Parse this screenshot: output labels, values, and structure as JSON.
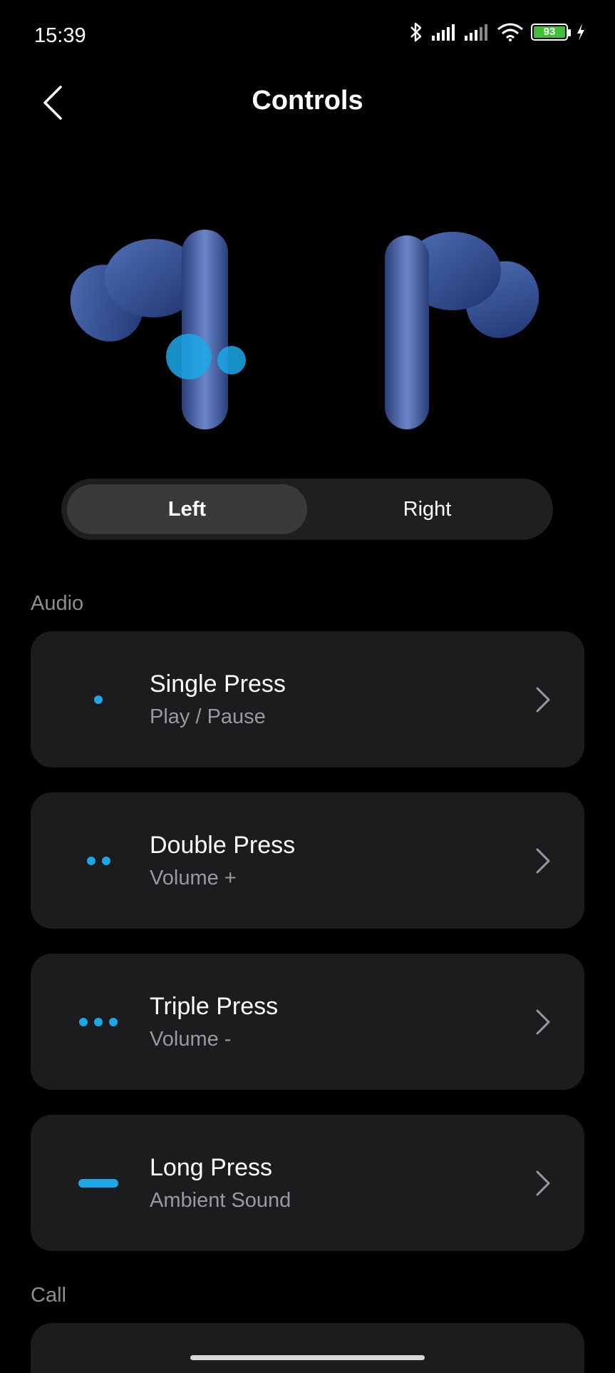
{
  "status": {
    "time": "15:39",
    "battery": "93",
    "icons": [
      "bluetooth-icon",
      "signal-icon",
      "signal-icon",
      "wifi-icon",
      "battery-icon",
      "charging-icon"
    ]
  },
  "header": {
    "title": "Controls",
    "back_icon": "back-chevron-icon"
  },
  "tabs": [
    {
      "label": "Left",
      "active": true
    },
    {
      "label": "Right",
      "active": false
    }
  ],
  "sections": {
    "audio": "Audio",
    "call": "Call"
  },
  "controls": [
    {
      "title": "Single Press",
      "action": "Play / Pause",
      "indicator": "single-dot-icon"
    },
    {
      "title": "Double Press",
      "action": "Volume +",
      "indicator": "double-dot-icon"
    },
    {
      "title": "Triple Press",
      "action": "Volume -",
      "indicator": "triple-dot-icon"
    },
    {
      "title": "Long Press",
      "action": "Ambient Sound",
      "indicator": "long-press-icon"
    }
  ],
  "colors": {
    "accent": "#1ca8e6",
    "card": "#1c1c1e",
    "background": "#000000"
  }
}
